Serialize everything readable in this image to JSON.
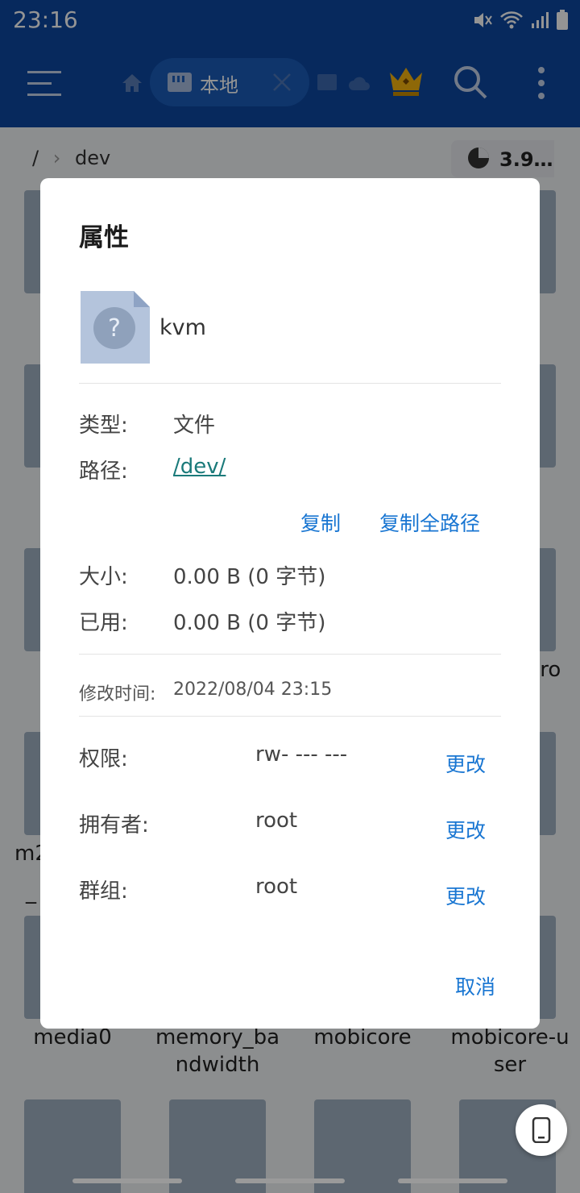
{
  "status_bar": {
    "time": "23:16"
  },
  "toolbar": {
    "tab_label": "本地"
  },
  "background": {
    "breadcrumb_root": "/",
    "breadcrumb_current": "dev",
    "storage": "3.9…",
    "visible_labels": [
      "tro",
      "m2",
      "_",
      "media0",
      "memory_ba\nndwidth",
      "mobicore",
      "mobicore-u\nser"
    ]
  },
  "dialog": {
    "title": "属性",
    "file_name": "kvm",
    "type_label": "类型:",
    "type_value": "文件",
    "path_label": "路径:",
    "path_value": "/dev/",
    "copy_label": "复制",
    "copy_full_path_label": "复制全路径",
    "size_label": "大小:",
    "size_value": "0.00 B (0 字节)",
    "used_label": "已用:",
    "used_value": "0.00 B (0 字节)",
    "modified_label": "修改时间:",
    "modified_value": "2022/08/04 23:15",
    "permission_label": "权限:",
    "permission_value": "rw- --- ---",
    "owner_label": "拥有者:",
    "owner_value": "root",
    "group_label": "群组:",
    "group_value": "root",
    "change_label": "更改",
    "cancel_label": "取消"
  },
  "colors": {
    "primary": "#0d47a1",
    "link": "#1976d2",
    "path": "#1a7a7a"
  }
}
